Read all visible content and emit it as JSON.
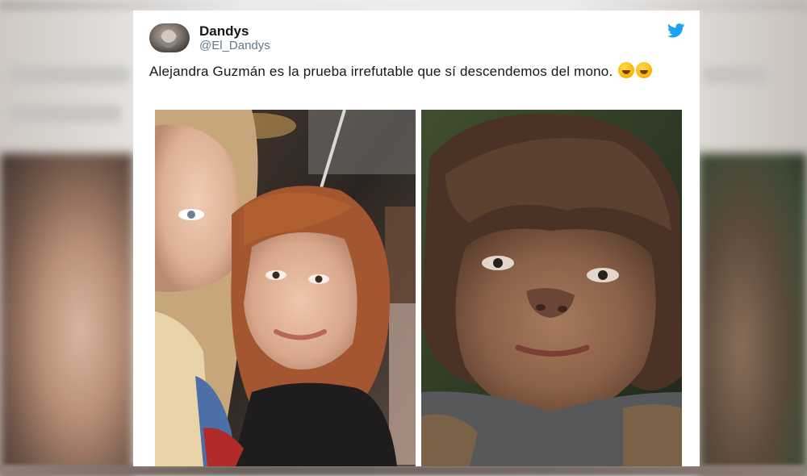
{
  "tweet": {
    "display_name": "Dandys",
    "handle": "@El_Dandys",
    "text": "Alejandra Guzmán es la prueba irrefutable que sí descendemos del mono.",
    "emoji_count": 2
  },
  "icons": {
    "brand": "twitter-bird-icon",
    "emoji": "rolling-on-floor-laughing-emoji"
  },
  "colors": {
    "twitter_blue": "#1da1f2",
    "text_primary": "#14171a",
    "text_secondary": "#657786"
  }
}
